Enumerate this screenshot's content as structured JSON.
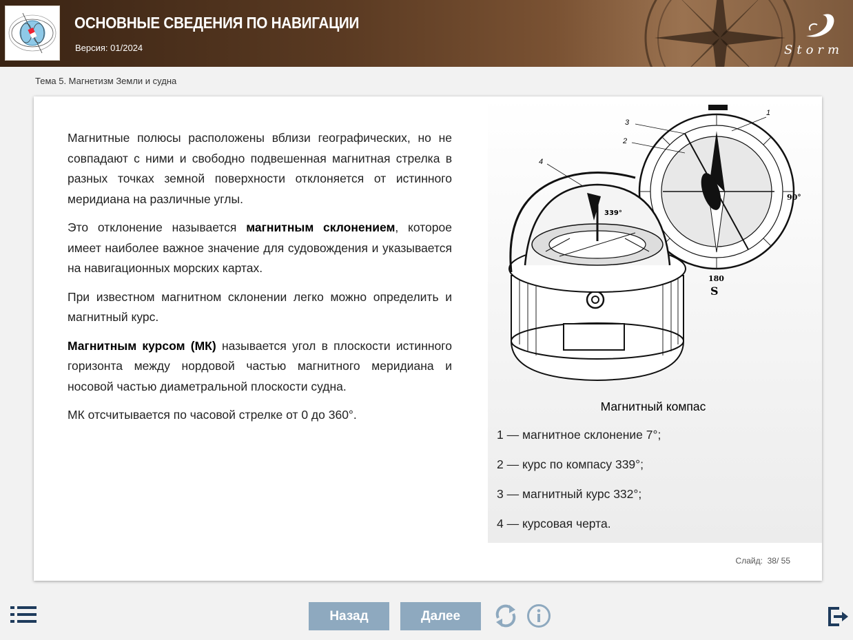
{
  "header": {
    "title": "ОСНОВНЫЕ СВЕДЕНИЯ ПО НАВИГАЦИИ",
    "version": "Версия: 01/2024",
    "brand": "Storm"
  },
  "topic": "Тема 5. Магнетизм Земли и судна",
  "content": {
    "p1": "Магнитные полюсы расположены вблизи географических, но не совпадают с ними и свободно подвешенная магнитная стрелка в разных точках земной поверхности отклоняется от истинного меридиана на различные углы.",
    "p2_a": "Это отклонение называется ",
    "p2_bold": "магнитным склонением",
    "p2_b": ", которое имеет наиболее важное значение для судовождения и указывается на навигационных морских картах.",
    "p3": "При известном магнитном склонении легко можно определить и магнитный курс.",
    "p4_bold": "Магнитным курсом (МК)",
    "p4_b": " называется угол в плоскости истинного горизонта между нордовой частью магнитного меридиана и носовой частью диаметральной плоскости судна.",
    "p5": "МК отсчитывается по часовой стрелке от 0 до 360°."
  },
  "figure": {
    "caption": "Магнитный компас",
    "labels": {
      "l1": "1",
      "l2": "2",
      "l3": "3",
      "l4": "4",
      "deg339": "339°",
      "deg90": "90°",
      "deg180": "180"
    },
    "legend": [
      "1 — магнитное склонение 7°;",
      "2 — курс по компасу 339°;",
      "3 — магнитный курс 332°;",
      "4 — курсовая черта."
    ]
  },
  "slide": {
    "label": "Слайд:",
    "current": "38",
    "sep": "/",
    "total": "55"
  },
  "footer": {
    "back_label": "Назад",
    "next_label": "Далее"
  },
  "colors": {
    "header_brown": "#5a3a22",
    "button_blue": "#8ea9bf",
    "icon_navy": "#1e3b5c"
  }
}
